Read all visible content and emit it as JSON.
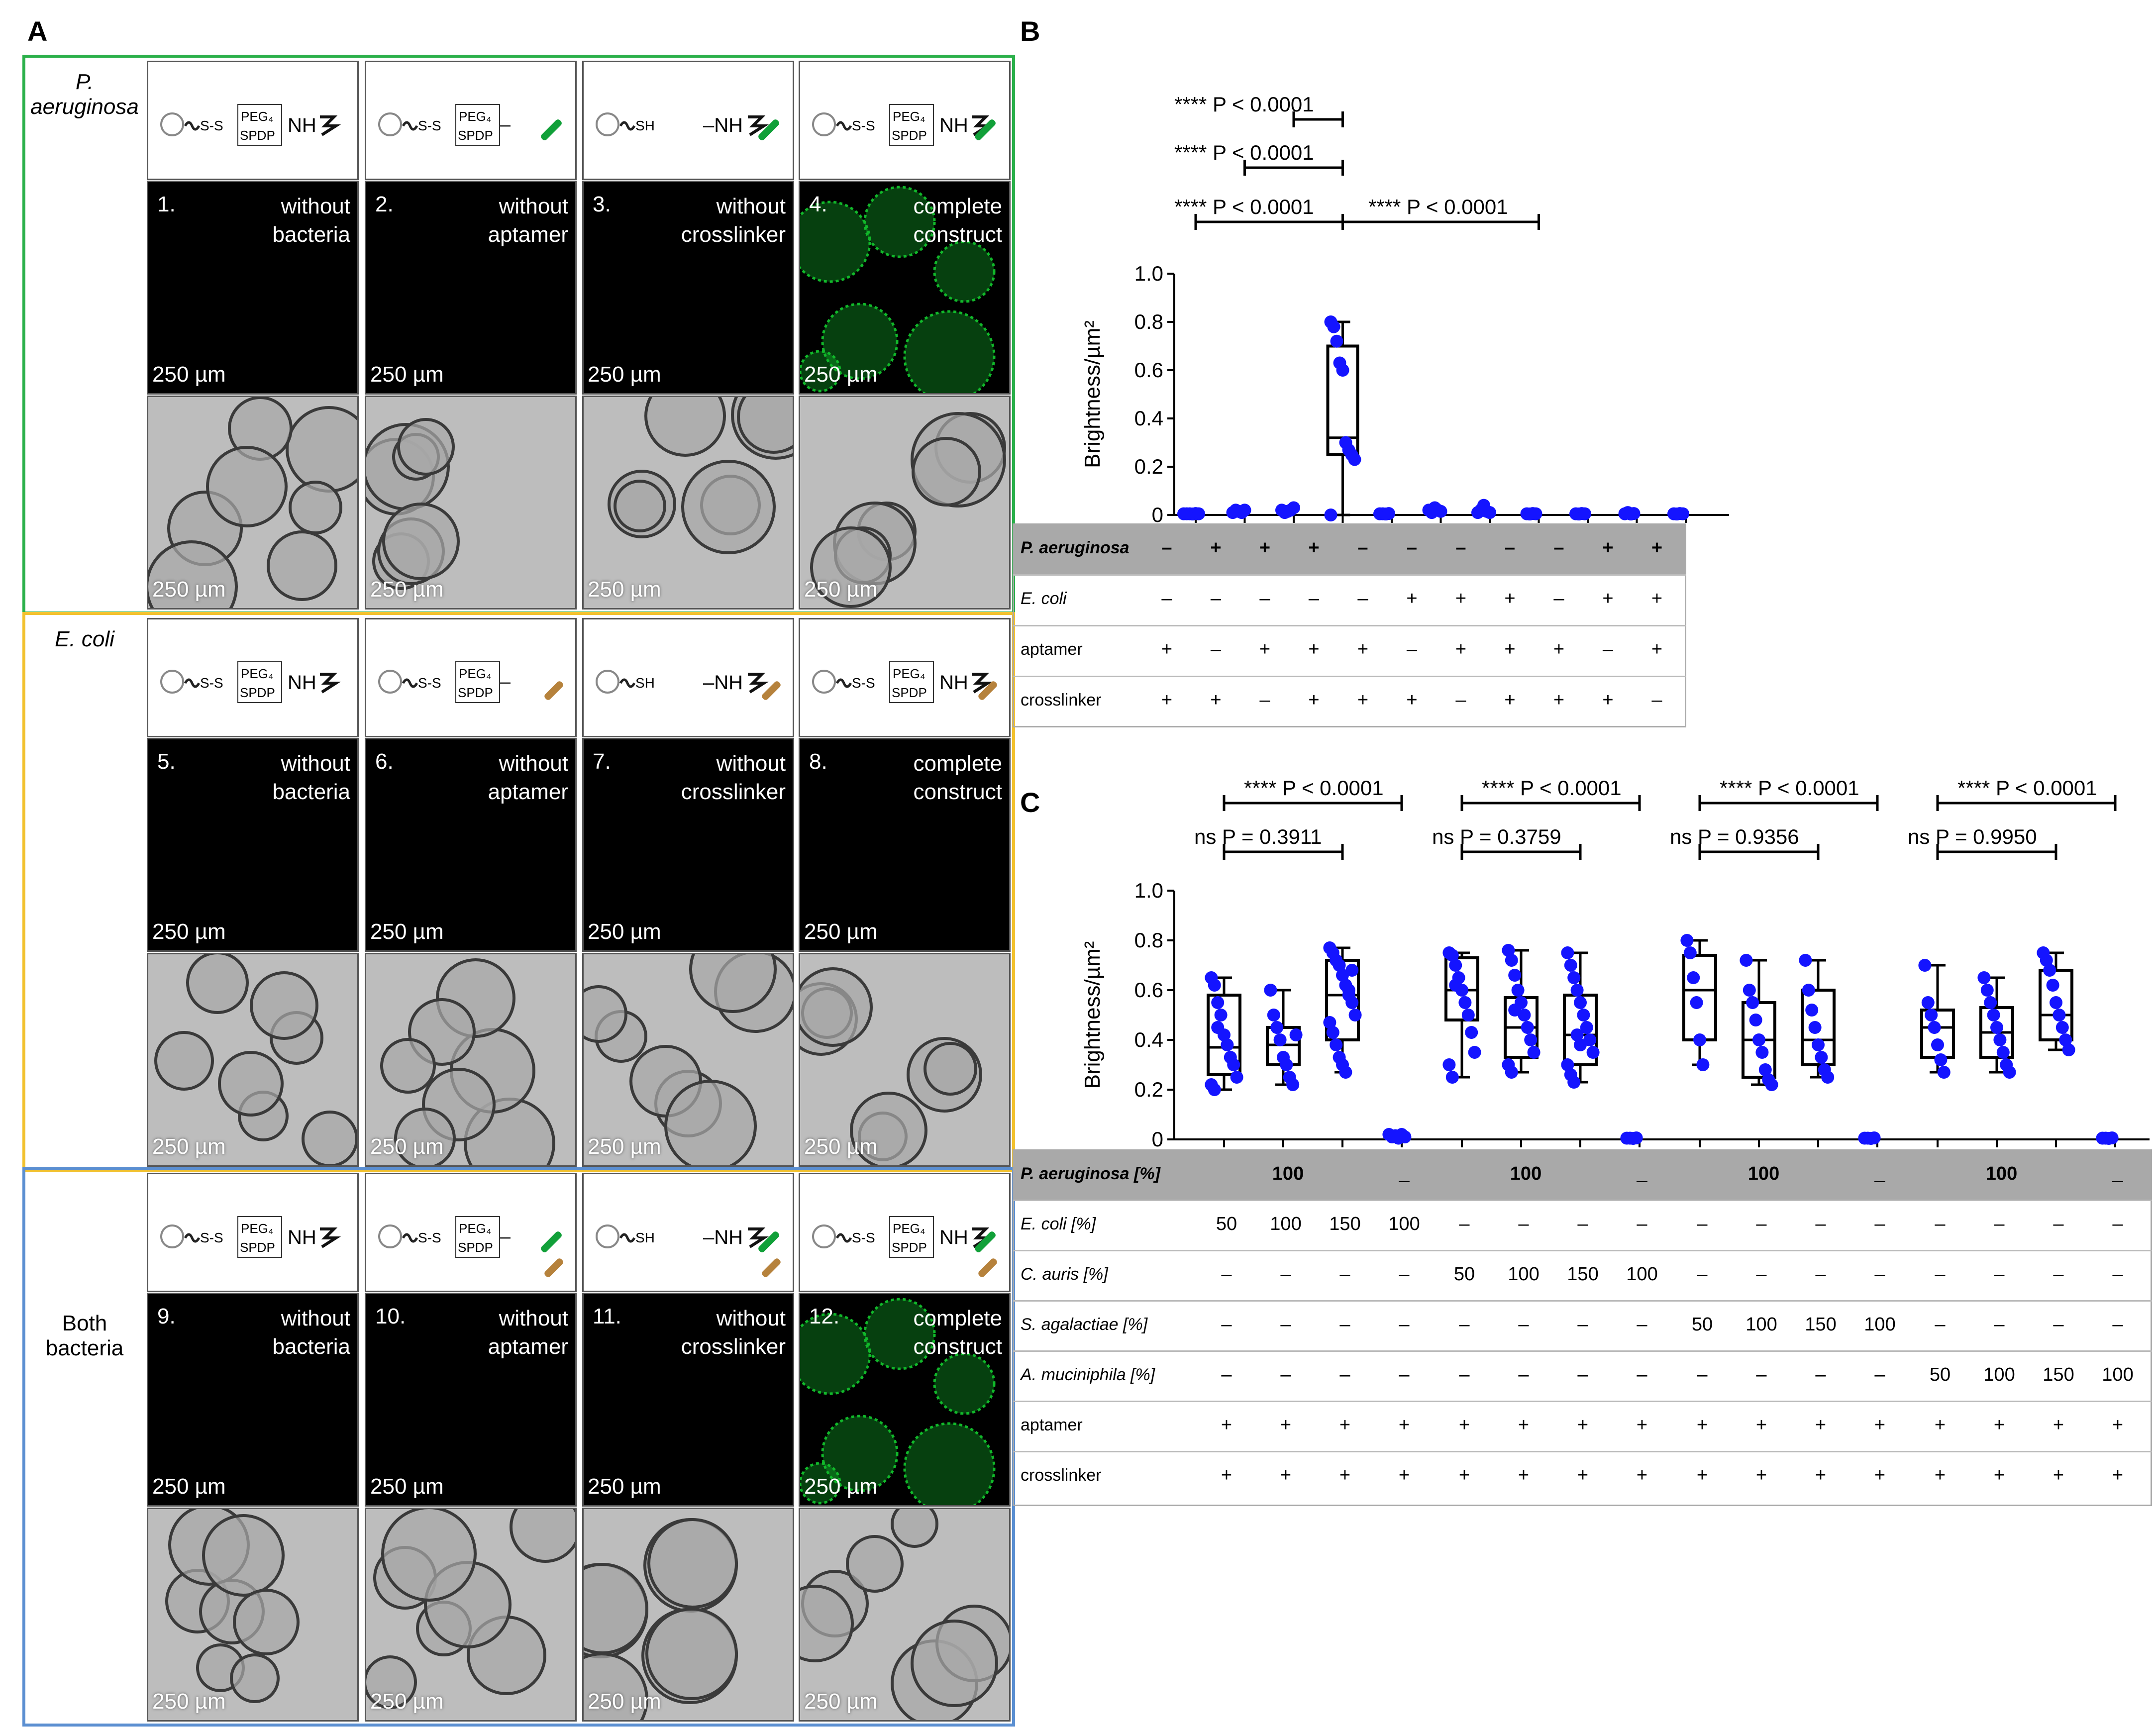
{
  "panels": {
    "a": "A",
    "b": "B",
    "c": "C"
  },
  "colors": {
    "p_aeruginosa_box": "#2bb04a",
    "e_coli_box": "#f2c12e",
    "both_box": "#5b8fd1",
    "dots": "#1414ff",
    "fluor_green": "#11b82a"
  },
  "groups": [
    {
      "label_italic": "P. aeruginosa",
      "label_plain": ""
    },
    {
      "label_italic": "E. coli",
      "label_plain": ""
    },
    {
      "label_italic": "",
      "label_plain": "Both bacteria"
    }
  ],
  "schematic": {
    "ss": "S-S",
    "peg4": "PEG₄",
    "spdp": "SPDP",
    "nh": "NH",
    "sh": "SH"
  },
  "conditions": [
    {
      "num": "1.",
      "line1": "without",
      "line2": "bacteria"
    },
    {
      "num": "2.",
      "line1": "without",
      "line2": "aptamer"
    },
    {
      "num": "3.",
      "line1": "without",
      "line2": "crosslinker"
    },
    {
      "num": "4.",
      "line1": "complete",
      "line2": "construct"
    },
    {
      "num": "5.",
      "line1": "without",
      "line2": "bacteria"
    },
    {
      "num": "6.",
      "line1": "without",
      "line2": "aptamer"
    },
    {
      "num": "7.",
      "line1": "without",
      "line2": "crosslinker"
    },
    {
      "num": "8.",
      "line1": "complete",
      "line2": "construct"
    },
    {
      "num": "9.",
      "line1": "without",
      "line2": "bacteria"
    },
    {
      "num": "10.",
      "line1": "without",
      "line2": "aptamer"
    },
    {
      "num": "11.",
      "line1": "without",
      "line2": "crosslinker"
    },
    {
      "num": "12.",
      "line1": "complete",
      "line2": "construct"
    }
  ],
  "scalebar": "250 µm",
  "chart_data": [
    {
      "panel": "B",
      "type": "box",
      "ylabel": "Brightness/µm²",
      "ylim": [
        0,
        1.0
      ],
      "yticks": [
        "0",
        "0.2",
        "0.4",
        "0.6",
        "0.8",
        "1.0"
      ],
      "groups": [
        {
          "points": [
            0.005,
            0.005,
            0.005,
            0.004,
            0.006,
            0.005
          ],
          "box": null
        },
        {
          "points": [
            0.01,
            0.02,
            0.015,
            0.01,
            0.02
          ],
          "box": null
        },
        {
          "points": [
            0.02,
            0.01,
            0.015,
            0.02,
            0.03
          ],
          "box": null
        },
        {
          "points": [
            0.8,
            0.78,
            0.72,
            0.63,
            0.6,
            0.3,
            0.27,
            0.25,
            0.23,
            0.0
          ],
          "box": {
            "min": 0.0,
            "q1": 0.25,
            "median": 0.32,
            "q3": 0.7,
            "max": 0.8
          }
        },
        {
          "points": [
            0.005,
            0.005,
            0.004,
            0.006
          ],
          "box": null
        },
        {
          "points": [
            0.02,
            0.01,
            0.03,
            0.02,
            0.015
          ],
          "box": null
        },
        {
          "points": [
            0.01,
            0.02,
            0.04,
            0.015,
            0.01
          ],
          "box": null
        },
        {
          "points": [
            0.005,
            0.004,
            0.006,
            0.005
          ],
          "box": null
        },
        {
          "points": [
            0.005,
            0.004,
            0.006,
            0.005
          ],
          "box": null
        },
        {
          "points": [
            0.005,
            0.01,
            0.004,
            0.006
          ],
          "box": null
        },
        {
          "points": [
            0.005,
            0.004,
            0.006,
            0.005
          ],
          "box": null
        }
      ],
      "significance": [
        {
          "from": 3,
          "to": 4,
          "label": "**** P < 0.0001"
        },
        {
          "from": 2,
          "to": 4,
          "label": "**** P < 0.0001"
        },
        {
          "from": 1,
          "to": 4,
          "label": "**** P < 0.0001"
        },
        {
          "from": 4,
          "to": 8,
          "label": "**** P < 0.0001"
        }
      ],
      "table": {
        "rows": [
          {
            "label": "P. aeruginosa",
            "italic": true,
            "values": [
              "–",
              "+",
              "+",
              "+",
              "–",
              "–",
              "–",
              "–",
              "–",
              "+",
              "+"
            ]
          },
          {
            "label": "E. coli",
            "italic": true,
            "values": [
              "–",
              "–",
              "–",
              "–",
              "–",
              "+",
              "+",
              "+",
              "–",
              "+",
              "+"
            ]
          },
          {
            "label": "aptamer",
            "italic": false,
            "values": [
              "+",
              "–",
              "+",
              "+",
              "+",
              "–",
              "+",
              "+",
              "+",
              "–",
              "+"
            ]
          },
          {
            "label": "crosslinker",
            "italic": false,
            "values": [
              "+",
              "+",
              "–",
              "+",
              "+",
              "+",
              "–",
              "+",
              "+",
              "+",
              "–"
            ]
          }
        ]
      }
    },
    {
      "panel": "C",
      "type": "box",
      "ylabel": "Brightness/µm²",
      "ylim": [
        0,
        1.0
      ],
      "yticks": [
        "0",
        "0.2",
        "0.4",
        "0.6",
        "0.8",
        "1.0"
      ],
      "groups": [
        {
          "points": [
            0.65,
            0.62,
            0.55,
            0.5,
            0.42,
            0.38,
            0.33,
            0.3,
            0.25,
            0.22,
            0.2,
            0.45
          ],
          "box": {
            "min": 0.2,
            "q1": 0.26,
            "median": 0.37,
            "q3": 0.58,
            "max": 0.65
          }
        },
        {
          "points": [
            0.6,
            0.5,
            0.45,
            0.4,
            0.33,
            0.3,
            0.25,
            0.22,
            0.42
          ],
          "box": {
            "min": 0.22,
            "q1": 0.3,
            "median": 0.38,
            "q3": 0.45,
            "max": 0.6
          }
        },
        {
          "points": [
            0.77,
            0.75,
            0.72,
            0.7,
            0.66,
            0.62,
            0.58,
            0.55,
            0.5,
            0.47,
            0.43,
            0.38,
            0.33,
            0.3,
            0.27,
            0.6,
            0.68
          ],
          "box": {
            "min": 0.27,
            "q1": 0.4,
            "median": 0.58,
            "q3": 0.72,
            "max": 0.77
          }
        },
        {
          "points": [
            0.02,
            0.01,
            0.015,
            0.005,
            0.02,
            0.01
          ],
          "box": null
        },
        {
          "points": [
            0.75,
            0.74,
            0.7,
            0.65,
            0.6,
            0.55,
            0.5,
            0.43,
            0.35,
            0.3,
            0.25,
            0.62
          ],
          "box": {
            "min": 0.25,
            "q1": 0.48,
            "median": 0.6,
            "q3": 0.73,
            "max": 0.75
          }
        },
        {
          "points": [
            0.76,
            0.72,
            0.66,
            0.6,
            0.55,
            0.5,
            0.45,
            0.4,
            0.35,
            0.3,
            0.27,
            0.52
          ],
          "box": {
            "min": 0.27,
            "q1": 0.33,
            "median": 0.45,
            "q3": 0.57,
            "max": 0.76
          }
        },
        {
          "points": [
            0.75,
            0.7,
            0.65,
            0.6,
            0.55,
            0.5,
            0.45,
            0.4,
            0.35,
            0.3,
            0.26,
            0.23,
            0.42,
            0.38
          ],
          "box": {
            "min": 0.23,
            "q1": 0.3,
            "median": 0.42,
            "q3": 0.58,
            "max": 0.75
          }
        },
        {
          "points": [
            0.005,
            0.005,
            0.004,
            0.006
          ],
          "box": null
        },
        {
          "points": [
            0.8,
            0.75,
            0.65,
            0.55,
            0.4,
            0.3
          ],
          "box": {
            "min": 0.3,
            "q1": 0.4,
            "median": 0.6,
            "q3": 0.74,
            "max": 0.8
          }
        },
        {
          "points": [
            0.72,
            0.6,
            0.55,
            0.48,
            0.4,
            0.35,
            0.28,
            0.24,
            0.22
          ],
          "box": {
            "min": 0.22,
            "q1": 0.25,
            "median": 0.4,
            "q3": 0.55,
            "max": 0.72
          }
        },
        {
          "points": [
            0.72,
            0.6,
            0.52,
            0.45,
            0.38,
            0.33,
            0.28,
            0.25
          ],
          "box": {
            "min": 0.25,
            "q1": 0.3,
            "median": 0.4,
            "q3": 0.6,
            "max": 0.72
          }
        },
        {
          "points": [
            0.005,
            0.005,
            0.004,
            0.006
          ],
          "box": null
        },
        {
          "points": [
            0.7,
            0.55,
            0.5,
            0.45,
            0.38,
            0.32,
            0.27
          ],
          "box": {
            "min": 0.27,
            "q1": 0.33,
            "median": 0.45,
            "q3": 0.52,
            "max": 0.7
          }
        },
        {
          "points": [
            0.65,
            0.6,
            0.55,
            0.5,
            0.45,
            0.4,
            0.35,
            0.3,
            0.27
          ],
          "box": {
            "min": 0.27,
            "q1": 0.33,
            "median": 0.43,
            "q3": 0.53,
            "max": 0.65
          }
        },
        {
          "points": [
            0.75,
            0.72,
            0.68,
            0.62,
            0.55,
            0.5,
            0.45,
            0.4,
            0.36
          ],
          "box": {
            "min": 0.36,
            "q1": 0.4,
            "median": 0.5,
            "q3": 0.68,
            "max": 0.75
          }
        },
        {
          "points": [
            0.005,
            0.005,
            0.004,
            0.006
          ],
          "box": null
        }
      ],
      "significance": [
        {
          "from": 1,
          "to": 4,
          "label": "**** P < 0.0001"
        },
        {
          "from": 5,
          "to": 8,
          "label": "**** P < 0.0001"
        },
        {
          "from": 9,
          "to": 12,
          "label": "**** P < 0.0001"
        },
        {
          "from": 13,
          "to": 16,
          "label": "**** P < 0.0001"
        },
        {
          "from": 1,
          "to": 3,
          "label": "ns P = 0.3911"
        },
        {
          "from": 5,
          "to": 7,
          "label": "ns P = 0.3759"
        },
        {
          "from": 9,
          "to": 11,
          "label": "ns P = 0.9356"
        },
        {
          "from": 13,
          "to": 15,
          "label": "ns P = 0.9950"
        }
      ],
      "table": {
        "first_row": {
          "label": "P. aeruginosa [%]",
          "italic": true,
          "values": [
            "100",
            "_",
            "100",
            "_",
            "100",
            "_",
            "100",
            "_"
          ]
        },
        "rows": [
          {
            "label": "E. coli [%]",
            "italic": true,
            "values": [
              "50",
              "100",
              "150",
              "100",
              "–",
              "–",
              "–",
              "–",
              "–",
              "–",
              "–",
              "–",
              "–",
              "–",
              "–",
              "–"
            ]
          },
          {
            "label": "C. auris [%]",
            "italic": true,
            "values": [
              "–",
              "–",
              "–",
              "–",
              "50",
              "100",
              "150",
              "100",
              "–",
              "–",
              "–",
              "–",
              "–",
              "–",
              "–",
              "–"
            ]
          },
          {
            "label": "S. agalactiae [%]",
            "italic": true,
            "values": [
              "–",
              "–",
              "–",
              "–",
              "–",
              "–",
              "–",
              "–",
              "50",
              "100",
              "150",
              "100",
              "–",
              "–",
              "–",
              "–"
            ]
          },
          {
            "label": "A. muciniphila [%]",
            "italic": true,
            "values": [
              "–",
              "–",
              "–",
              "–",
              "–",
              "–",
              "–",
              "–",
              "–",
              "–",
              "–",
              "–",
              "50",
              "100",
              "150",
              "100"
            ]
          },
          {
            "label": "aptamer",
            "italic": false,
            "values": [
              "+",
              "+",
              "+",
              "+",
              "+",
              "+",
              "+",
              "+",
              "+",
              "+",
              "+",
              "+",
              "+",
              "+",
              "+",
              "+"
            ]
          },
          {
            "label": "crosslinker",
            "italic": false,
            "values": [
              "+",
              "+",
              "+",
              "+",
              "+",
              "+",
              "+",
              "+",
              "+",
              "+",
              "+",
              "+",
              "+",
              "+",
              "+",
              "+"
            ]
          }
        ]
      }
    }
  ]
}
